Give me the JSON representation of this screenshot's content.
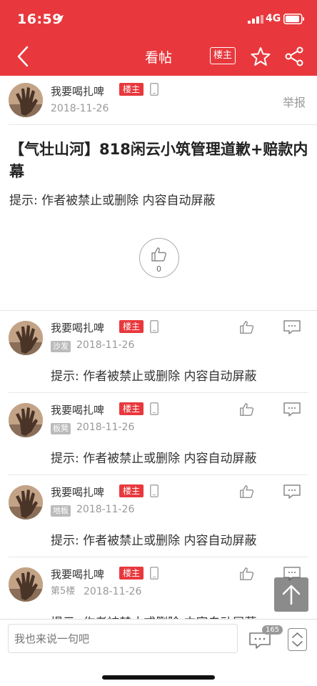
{
  "status_bar": {
    "time": "16:59",
    "network": "4G"
  },
  "nav": {
    "title": "看帖",
    "louzhu_label": "楼主"
  },
  "op": {
    "username": "我要喝扎啤",
    "badge": "楼主",
    "date": "2018-11-26",
    "report_label": "举报",
    "title": "【气壮山河】818闲云小筑管理道歉+赔款内幕",
    "body": "提示: 作者被禁止或删除 内容自动屏蔽",
    "likes": "0"
  },
  "replies": [
    {
      "username": "我要喝扎啤",
      "badge": "楼主",
      "floor": "沙发",
      "date": "2018-11-26",
      "text": "提示: 作者被禁止或删除 内容自动屏蔽"
    },
    {
      "username": "我要喝扎啤",
      "badge": "楼主",
      "floor": "板凳",
      "date": "2018-11-26",
      "text": "提示: 作者被禁止或删除 内容自动屏蔽"
    },
    {
      "username": "我要喝扎啤",
      "badge": "楼主",
      "floor": "地板",
      "date": "2018-11-26",
      "text": "提示: 作者被禁止或删除 内容自动屏蔽"
    },
    {
      "username": "我要喝扎啤",
      "badge": "楼主",
      "floor": "第5楼",
      "date": "2018-11-26",
      "text": "提示: 作者被禁止或删除 内容自动屏蔽"
    }
  ],
  "bottom_bar": {
    "input_placeholder": "我也来说一句吧",
    "comment_count": "165"
  },
  "colors": {
    "brand": "#e8383d"
  }
}
